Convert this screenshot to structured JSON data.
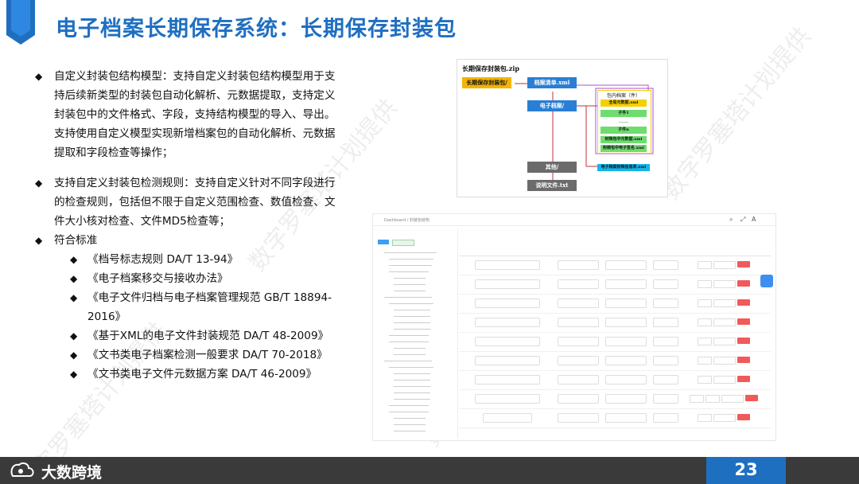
{
  "title": "电子档案长期保存系统：长期保存封装包",
  "bullets": [
    {
      "text": "自定义封装包结构模型：支持自定义封装包结构模型用于支持后续新类型的封装包自动化解析、元数据提取，支持定义封装包中的文件格式、字段，支持结构模型的导入、导出。支持使用自定义模型实现新增档案包的自动化解析、元数据提取和字段检查等操作；"
    },
    {
      "text": "支持自定义封装包检测规则：支持自定义针对不同字段进行的检查规则，包括但不限于自定义范围检查、数值检查、文件大小核对检查、文件MD5检查等；"
    },
    {
      "text": "符合标准"
    }
  ],
  "standards": [
    "《档号标志规则 DA/T 13-94》",
    "《电子档案移交与接收办法》",
    "《电子文件归档与电子档案管理规范 GB/T 18894-2016》",
    "《基于XML的电子文件封装规范 DA/T 48-2009》",
    "《文书类电子档案检测一般要求 DA/T 70-2018》",
    "《文书类电子文件元数据方案 DA/T 46-2009》"
  ],
  "bullet_glyph": "◆",
  "diagram": {
    "caption": "长期保存封装包.zip",
    "root": "长期保存封装包/",
    "manifest": "档案清单.xml",
    "archive": "电子档案/",
    "other": "其他/",
    "readme": "说明文件.txt",
    "archive_items": [
      "包内档案（件）",
      "全局元数据.xml",
      "子件1",
      "……",
      "子件n",
      "封档包中元数据.xml",
      "封档包中电子签名.xml"
    ],
    "other_item": "电子档案封档信息表.xml",
    "colors": {
      "root": "#f5b400",
      "blue": "#2a7fd4",
      "gray": "#6b6b6b",
      "green": "#6fdc6f",
      "yellow": "#f5d000",
      "cyan": "#17b5e8"
    }
  },
  "screenshot": {
    "breadcrumb": "Dashboard  /  封装包结构"
  },
  "footer": {
    "logo": "大数跨境",
    "page": "23"
  },
  "watermark": "数字罗塞塔计划提供"
}
